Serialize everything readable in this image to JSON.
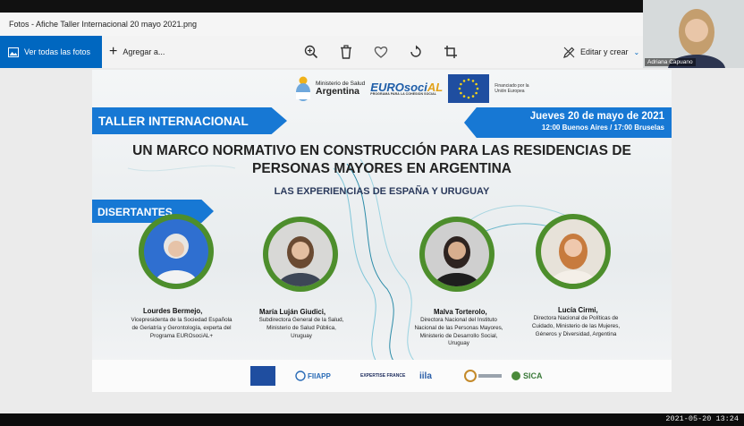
{
  "window": {
    "title": "Fotos - Afiche Taller Internacional 20 mayo 2021.png"
  },
  "toolbar": {
    "see_all": "Ver todas las fotos",
    "add": "Agregar a...",
    "edit": "Editar y crear",
    "icons": [
      "zoom-in-icon",
      "delete-icon",
      "heart-icon",
      "rotate-icon",
      "crop-icon"
    ]
  },
  "poster": {
    "ministry_small": "Ministerio de Salud",
    "ministry_big": "Argentina",
    "eurosocial_a": "EUROsoci",
    "eurosocial_b": "AL",
    "eurosocial_tag": "PROGRAMA PARA LA COHESION SOCIAL",
    "financed": "Financiado por la Unión Europea",
    "event_label": "TALLER INTERNACIONAL",
    "date": "Jueves 20 de mayo de 2021",
    "time": "12:00 Buenos Aires / 17:00 Bruselas",
    "title_line1": "UN MARCO NORMATIVO EN CONSTRUCCIÓN PARA LAS RESIDENCIAS DE",
    "title_line2": "PERSONAS MAYORES EN ARGENTINA",
    "subtitle": "LAS EXPERIENCIAS DE ESPAÑA Y URUGUAY",
    "speakers_label": "DISERTANTES",
    "speakers": [
      {
        "name": "Lourdes Bermejo,",
        "role": "Vicepresidenta de la Sociedad Española de Geriatría y Gerontología, experta del Programa EUROsociAL+"
      },
      {
        "name": "María Luján Giudici,",
        "role": "Subdirectora General de la Salud, Ministerio de Salud Pública, Uruguay"
      },
      {
        "name": "Malva Torterolo,",
        "role": "Directora Nacional del Instituto Nacional de las Personas Mayores, Ministerio de Desarrollo Social, Uruguay"
      },
      {
        "name": "Lucía Cirmi,",
        "role": "Directora Nacional de Políticas de Cuidado, Ministerio de las Mujeres, Géneros y Diversidad, Argentina"
      }
    ],
    "footer_logos": [
      "FIIAPP",
      "EXPERTISE FRANCE",
      "iila",
      "SICA"
    ]
  },
  "participant": {
    "name": "Adriana Capuano"
  },
  "taskbar": {
    "clock": "2021-05-20 13:24"
  },
  "colors": {
    "accent_blue": "#0067c0",
    "poster_blue": "#1778d4",
    "speaker_ring": "#4d8e2c"
  }
}
